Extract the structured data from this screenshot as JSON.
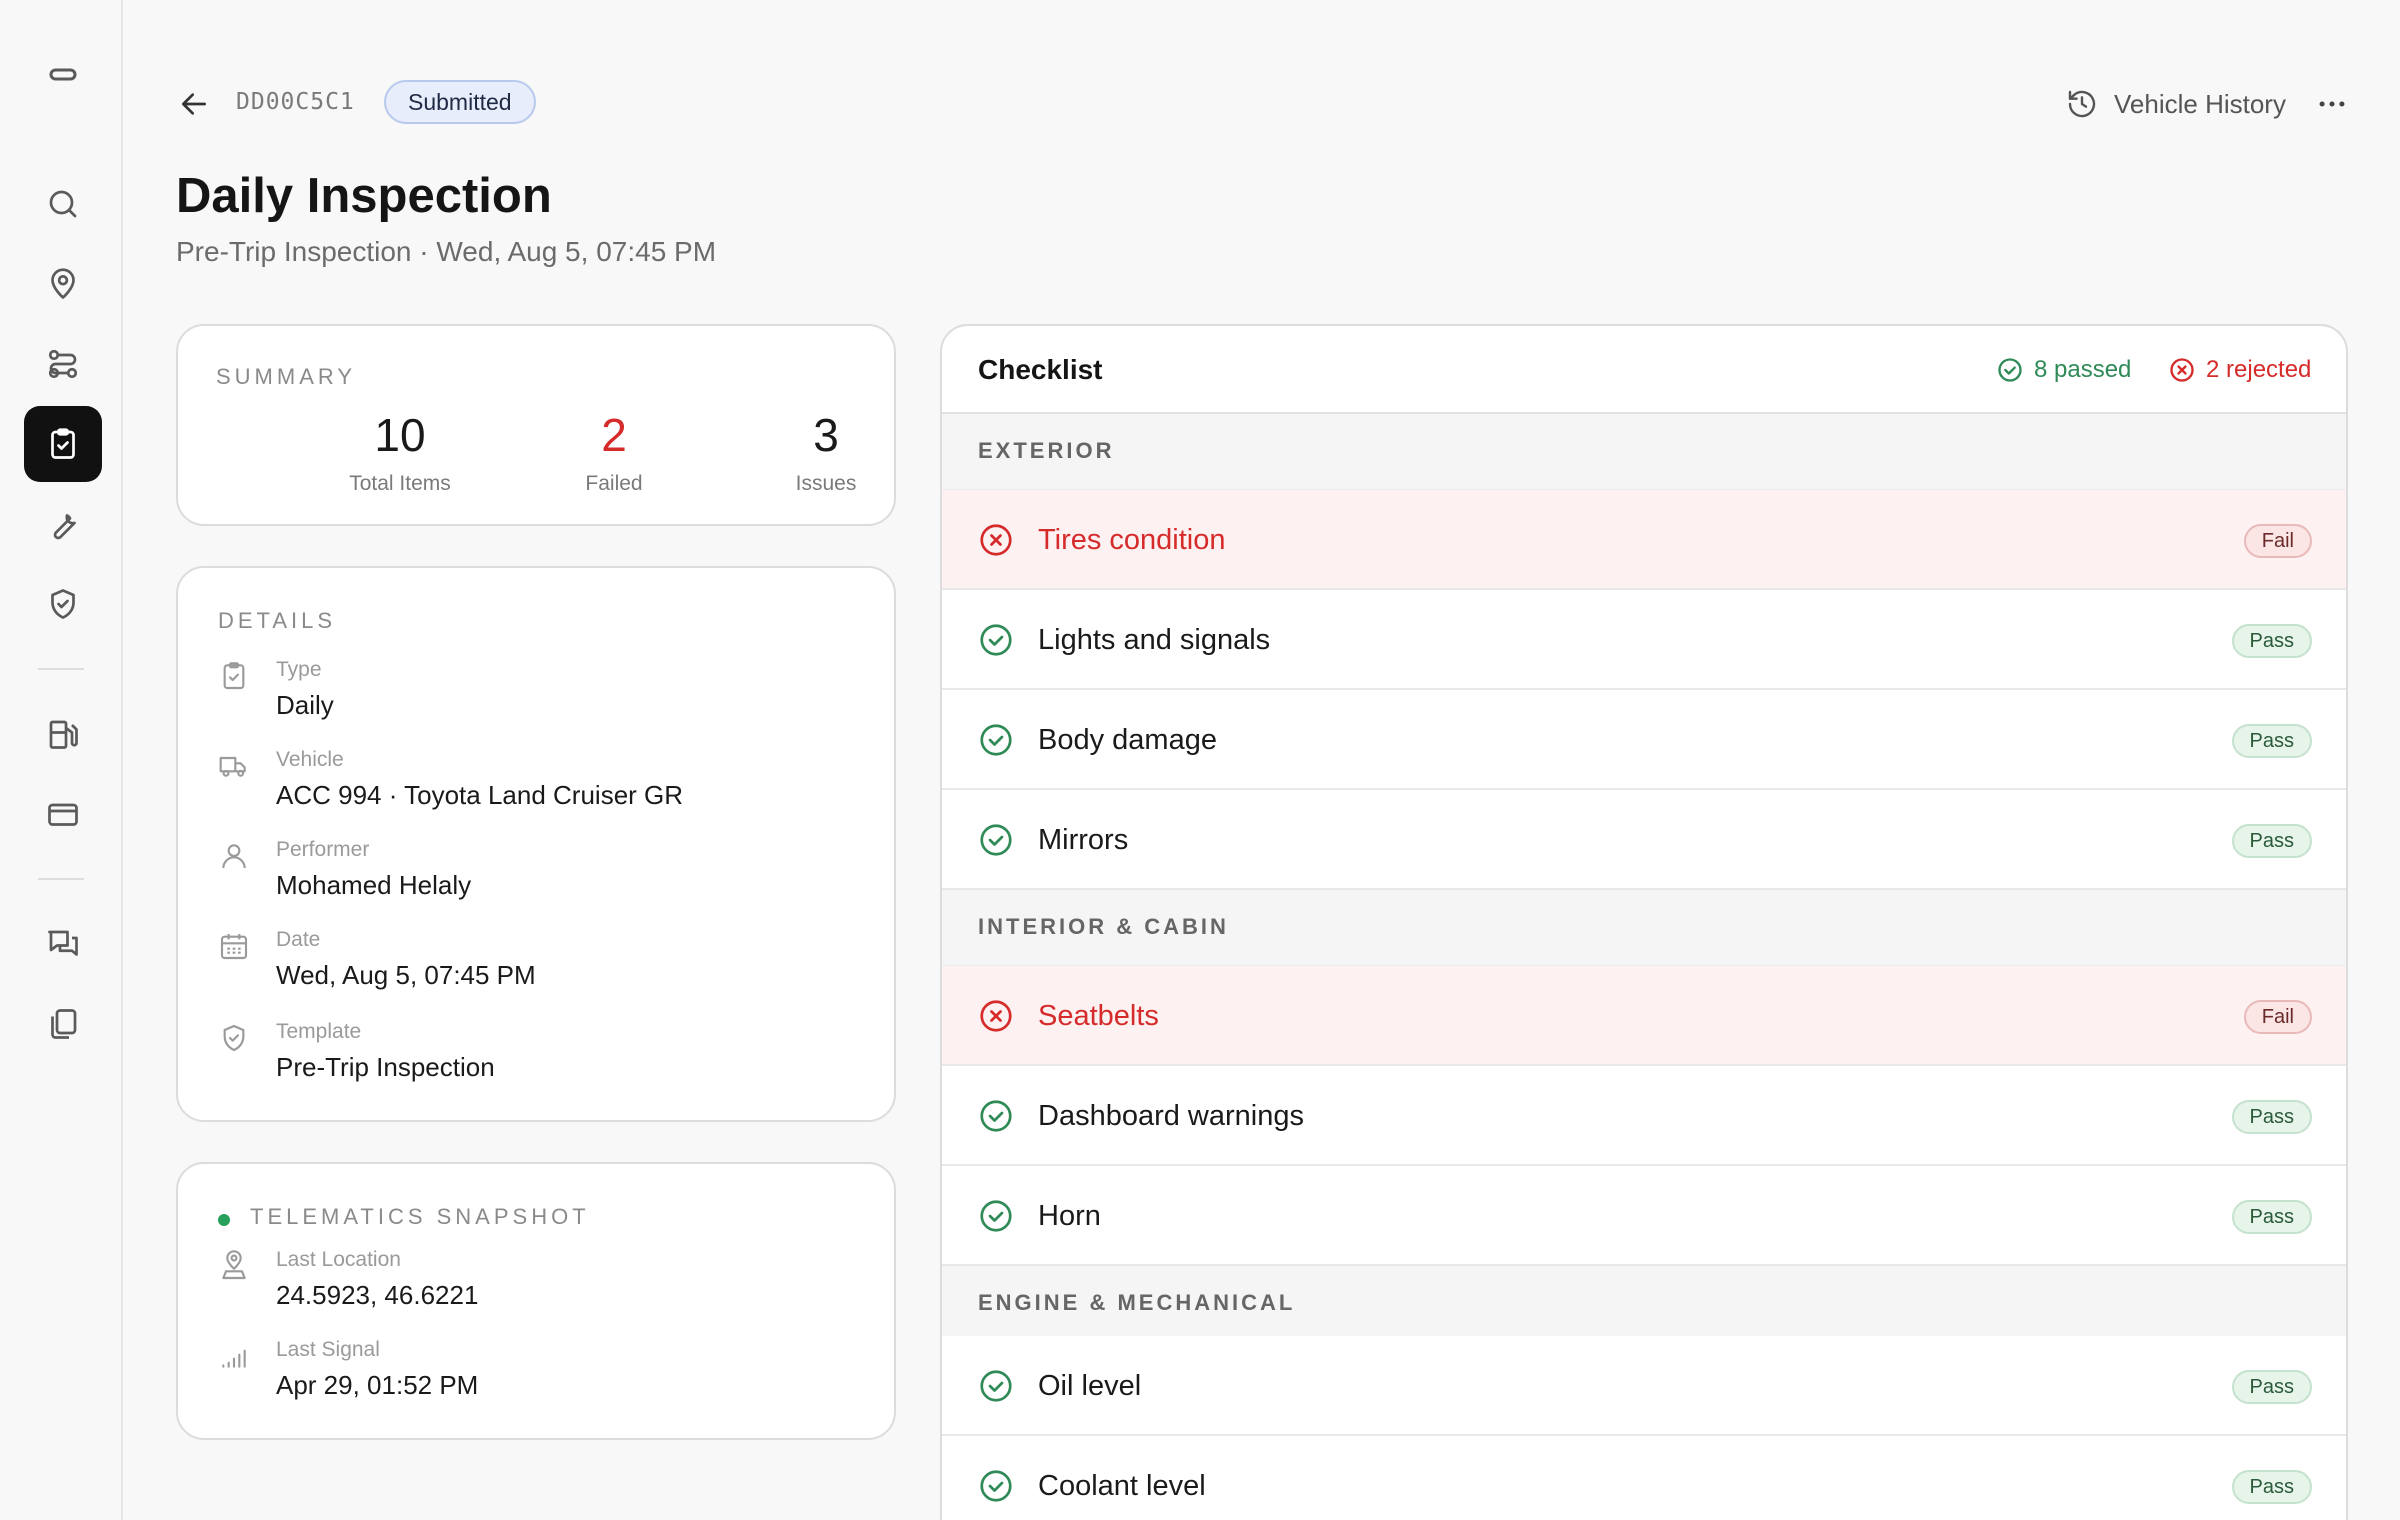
{
  "header": {
    "record_id": "DD00C5C1",
    "status": "Submitted",
    "vehicle_history_label": "Vehicle History",
    "title": "Daily Inspection",
    "subtitle": "Pre-Trip Inspection · Wed, Aug 5, 07:45 PM"
  },
  "sidebar": {
    "items": [
      {
        "icon": "logo-icon"
      },
      {
        "icon": "search-icon"
      },
      {
        "icon": "map-pin-icon"
      },
      {
        "icon": "route-icon"
      },
      {
        "icon": "clipboard-check-icon",
        "active": true
      },
      {
        "icon": "wrench-icon"
      },
      {
        "icon": "shield-check-icon"
      },
      {
        "icon": "fuel-icon"
      },
      {
        "icon": "credit-card-icon"
      },
      {
        "icon": "messages-icon"
      },
      {
        "icon": "documents-icon"
      }
    ]
  },
  "summary": {
    "label": "SUMMARY",
    "total_value": "10",
    "total_label": "Total Items",
    "failed_value": "2",
    "failed_label": "Failed",
    "issues_value": "3",
    "issues_label": "Issues"
  },
  "details": {
    "label": "DETAILS",
    "type_label": "Type",
    "type_value": "Daily",
    "vehicle_label": "Vehicle",
    "vehicle_value": "ACC 994 · Toyota Land Cruiser GR",
    "performer_label": "Performer",
    "performer_value": "Mohamed Helaly",
    "date_label": "Date",
    "date_value": "Wed, Aug 5, 07:45 PM",
    "template_label": "Template",
    "template_value": "Pre-Trip Inspection"
  },
  "telematics": {
    "label": "TELEMATICS SNAPSHOT",
    "location_label": "Last Location",
    "location_value": "24.5923, 46.6221",
    "signal_label": "Last Signal",
    "signal_value": "Apr 29, 01:52 PM"
  },
  "checklist": {
    "title": "Checklist",
    "passed": "8 passed",
    "rejected": "2 rejected",
    "groups": [
      {
        "name": "EXTERIOR",
        "items": [
          {
            "name": "Tires condition",
            "status": "Fail"
          },
          {
            "name": "Lights and signals",
            "status": "Pass"
          },
          {
            "name": "Body damage",
            "status": "Pass"
          },
          {
            "name": "Mirrors",
            "status": "Pass"
          }
        ]
      },
      {
        "name": "INTERIOR & CABIN",
        "items": [
          {
            "name": "Seatbelts",
            "status": "Fail"
          },
          {
            "name": "Dashboard warnings",
            "status": "Pass"
          },
          {
            "name": "Horn",
            "status": "Pass"
          }
        ]
      },
      {
        "name": "ENGINE & MECHANICAL",
        "items": [
          {
            "name": "Oil level",
            "status": "Pass"
          },
          {
            "name": "Coolant level",
            "status": "Pass"
          }
        ]
      }
    ]
  },
  "colors": {
    "pass": "#2f8a57",
    "fail": "#d62b2b",
    "active_nav": "#111111"
  }
}
